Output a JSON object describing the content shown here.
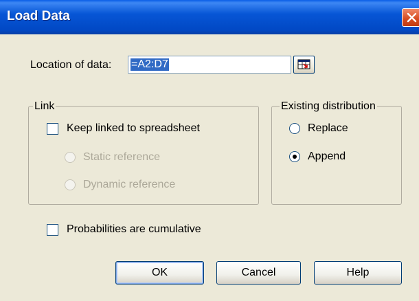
{
  "window": {
    "title": "Load Data",
    "close_icon": "close-icon"
  },
  "location": {
    "label": "Location of data:",
    "value": "=A2:D7",
    "ref_icon": "range-select-icon"
  },
  "link_group": {
    "legend": "Link",
    "keep_linked_label": "Keep linked to spreadsheet",
    "keep_linked_checked": false,
    "static_label": "Static reference",
    "dynamic_label": "Dynamic reference"
  },
  "existing_group": {
    "legend": "Existing distribution",
    "replace_label": "Replace",
    "append_label": "Append",
    "selected": "Append"
  },
  "cumulative": {
    "label": "Probabilities are cumulative",
    "checked": false
  },
  "buttons": {
    "ok": "OK",
    "cancel": "Cancel",
    "help": "Help"
  },
  "colors": {
    "titlebar": "#0148c4",
    "dialog_bg": "#ece9d8",
    "selection": "#316ac5",
    "close_button": "#d64a1f"
  }
}
